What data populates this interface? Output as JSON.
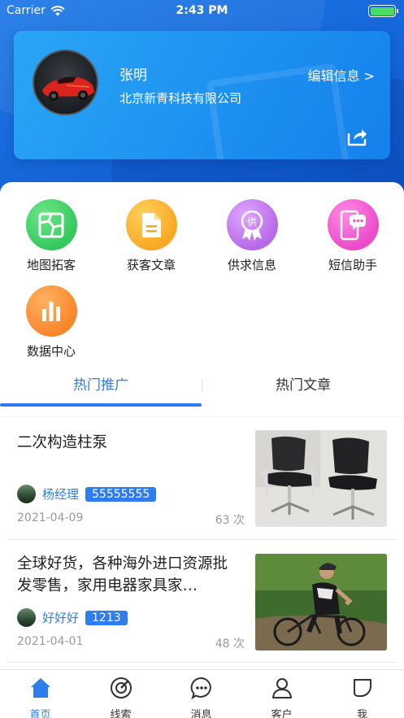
{
  "status_bar": {
    "carrier": "Carrier",
    "time": "2:43 PM"
  },
  "profile": {
    "name": "张明",
    "company": "北京新青科技有限公司",
    "edit_label": "编辑信息 >"
  },
  "features": [
    {
      "label": "地图拓客",
      "icon": "map-icon",
      "color": "#3fd06a"
    },
    {
      "label": "获客文章",
      "icon": "document-icon",
      "color": "#fbb32a"
    },
    {
      "label": "供求信息",
      "icon": "badge-icon",
      "color": "#c57ef0"
    },
    {
      "label": "短信助手",
      "icon": "sms-phone-icon",
      "color": "#f25ad0"
    },
    {
      "label": "数据中心",
      "icon": "bar-chart-icon",
      "color": "#fb8a2a"
    }
  ],
  "tabs": [
    {
      "label": "热门推广",
      "active": true
    },
    {
      "label": "热门文章",
      "active": false
    }
  ],
  "list": [
    {
      "title": "二次构造柱泵",
      "author": "杨经理",
      "phone": "55555555",
      "date": "2021-04-09",
      "views": "63 次"
    },
    {
      "title": "全球好货，各种海外进口资源批发零售，家用电器家具家…",
      "author": "好好好",
      "phone": "1213",
      "date": "2021-04-01",
      "views": "48 次"
    }
  ],
  "tabbar": [
    {
      "label": "首页",
      "icon": "home-icon",
      "active": true
    },
    {
      "label": "线索",
      "icon": "target-icon",
      "active": false
    },
    {
      "label": "消息",
      "icon": "chat-icon",
      "active": false
    },
    {
      "label": "客户",
      "icon": "person-icon",
      "active": false
    },
    {
      "label": "我",
      "icon": "profile-leaf-icon",
      "active": false
    }
  ],
  "colors": {
    "accent": "#2e7cf0",
    "header": "#1565d8"
  }
}
